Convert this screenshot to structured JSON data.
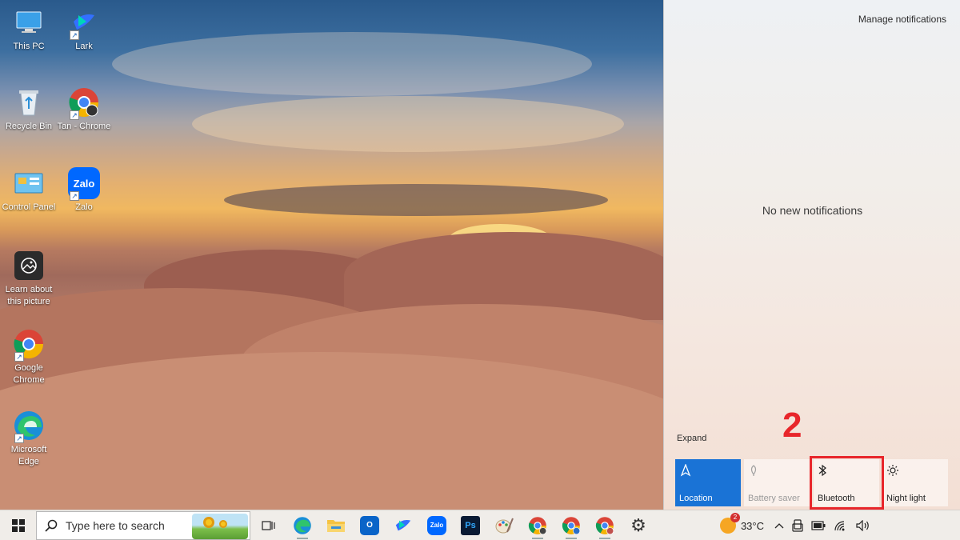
{
  "desktop": {
    "icons": [
      {
        "label": "This PC",
        "icon": "this-pc-icon"
      },
      {
        "label": "Lark",
        "icon": "lark-icon"
      },
      {
        "label": "Recycle Bin",
        "icon": "recycle-bin-icon"
      },
      {
        "label": "Tan - Chrome",
        "icon": "chrome-profile-icon"
      },
      {
        "label": "Control Panel",
        "icon": "control-panel-icon"
      },
      {
        "label": "Zalo",
        "icon": "zalo-icon"
      },
      {
        "label": "Learn about this picture",
        "icon": "learn-picture-icon"
      },
      {
        "label": "Google Chrome",
        "icon": "chrome-icon"
      },
      {
        "label": "Microsoft Edge",
        "icon": "edge-icon"
      }
    ],
    "zalo_glyph": "Zalo"
  },
  "action_center": {
    "manage_label": "Manage notifications",
    "empty_message": "No new notifications",
    "expand_label": "Expand",
    "step_marker": "2",
    "quick_actions": [
      {
        "label": "Location",
        "icon": "location-icon",
        "state": "on"
      },
      {
        "label": "Battery saver",
        "icon": "battery-saver-icon",
        "state": "disabled"
      },
      {
        "label": "Bluetooth",
        "icon": "bluetooth-icon",
        "state": "off",
        "highlighted": true
      },
      {
        "label": "Night light",
        "icon": "night-light-icon",
        "state": "off"
      }
    ]
  },
  "taskbar": {
    "search_placeholder": "Type here to search",
    "apps": [
      {
        "name": "task-view",
        "glyph": ""
      },
      {
        "name": "edge",
        "glyph": "e"
      },
      {
        "name": "file-explorer",
        "glyph": ""
      },
      {
        "name": "outlook",
        "glyph": "O"
      },
      {
        "name": "lark",
        "glyph": ""
      },
      {
        "name": "zalo",
        "glyph": "Zalo"
      },
      {
        "name": "photoshop",
        "glyph": "Ps"
      },
      {
        "name": "paint",
        "glyph": ""
      },
      {
        "name": "chrome-1",
        "glyph": ""
      },
      {
        "name": "chrome-2",
        "glyph": ""
      },
      {
        "name": "chrome-3",
        "glyph": ""
      },
      {
        "name": "settings",
        "glyph": "⚙"
      }
    ],
    "weather": {
      "temperature": "33°C",
      "badge": "2"
    }
  },
  "colors": {
    "accent": "#1a73d6",
    "highlight": "#e8262b"
  }
}
